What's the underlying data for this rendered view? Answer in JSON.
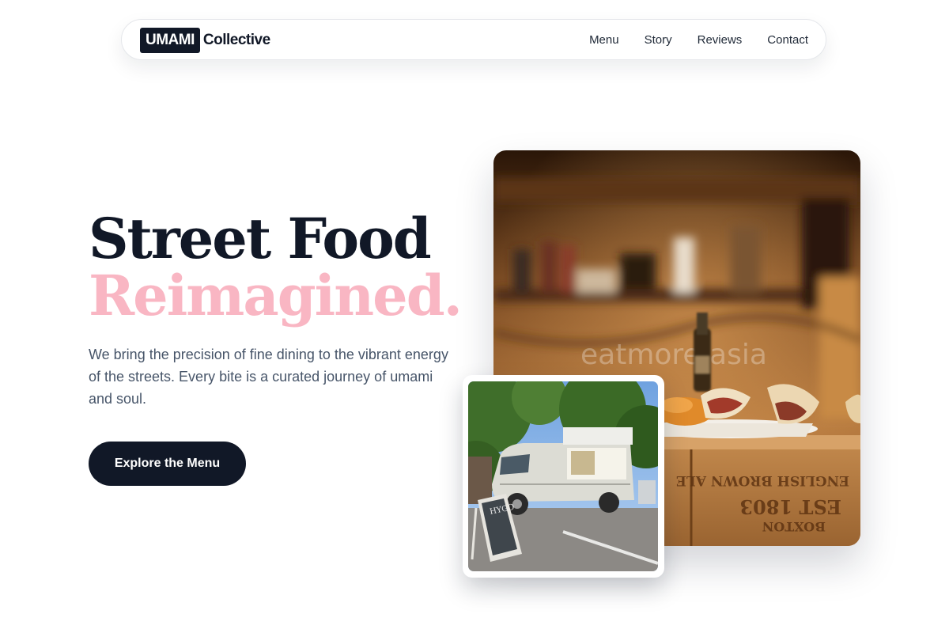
{
  "brand": {
    "logo_box": "UMAMI",
    "logo_text": "Collective"
  },
  "nav": {
    "links": [
      "Menu",
      "Story",
      "Reviews",
      "Contact"
    ]
  },
  "hero": {
    "title_line1": "Street Food",
    "title_line2": "Reimagined.",
    "description": "We bring the precision of fine dining to the vibrant energy of the streets. Every bite is a curated journey of umami and soul.",
    "cta_label": "Explore the Menu"
  },
  "images": {
    "main_watermark": "eatmore.asia",
    "crate_text_lines": [
      "BOXTON",
      "EST 1803",
      "ENGLISH BROWN ALE"
    ],
    "chalkboard_text": "HYGO"
  },
  "colors": {
    "dark": "#111827",
    "accent_pink": "#f9b6c3",
    "body_text": "#475569"
  },
  "icons": []
}
